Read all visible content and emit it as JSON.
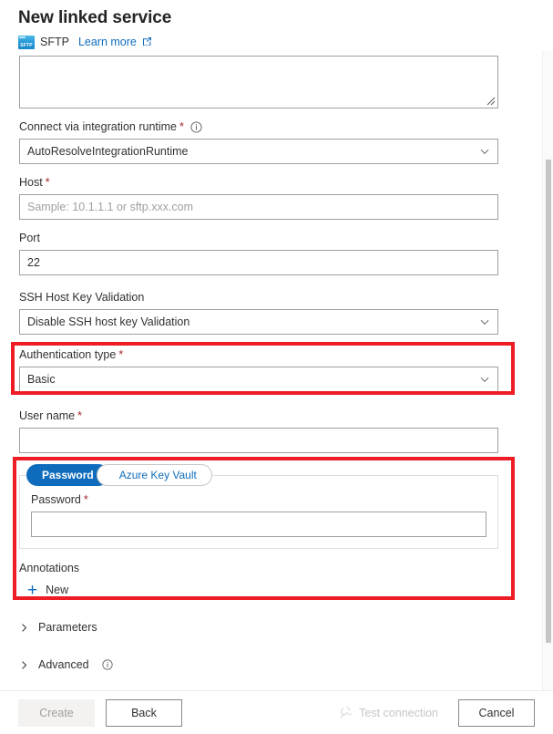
{
  "header": {
    "title": "New linked service",
    "service_icon": "sftp-icon",
    "service_tag": "SFTP",
    "service_label": "SFTP",
    "learn_more": "Learn more",
    "external_link_icon": "external-link-icon"
  },
  "form": {
    "description": {
      "value": "",
      "resize_grip_icon": "resize-grip-icon"
    },
    "integration_runtime": {
      "label": "Connect via integration runtime",
      "required": "*",
      "info_icon": "info-icon",
      "value": "AutoResolveIntegrationRuntime",
      "chevron_icon": "chevron-down-icon"
    },
    "host": {
      "label": "Host",
      "required": "*",
      "value": "",
      "placeholder": "Sample: 10.1.1.1 or sftp.xxx.com"
    },
    "port": {
      "label": "Port",
      "value": "22"
    },
    "ssh_host_key_validation": {
      "label": "SSH Host Key Validation",
      "value": "Disable SSH host key Validation",
      "chevron_icon": "chevron-down-icon"
    },
    "authentication_type": {
      "label": "Authentication type",
      "required": "*",
      "value": "Basic",
      "chevron_icon": "chevron-down-icon"
    },
    "user_name": {
      "label": "User name",
      "required": "*",
      "value": ""
    },
    "credential_tabs": {
      "password_label": "Password",
      "key_vault_label": "Azure Key Vault",
      "active": "Password"
    },
    "password": {
      "label": "Password",
      "required": "*",
      "value": ""
    },
    "annotations": {
      "label": "Annotations",
      "new_label": "New",
      "plus_icon": "plus-icon"
    },
    "parameters": {
      "label": "Parameters",
      "caret_icon": "chevron-right-icon"
    },
    "advanced": {
      "label": "Advanced",
      "caret_icon": "chevron-right-icon",
      "info_icon": "info-icon"
    }
  },
  "footer": {
    "create_label": "Create",
    "back_label": "Back",
    "test_connection_label": "Test connection",
    "test_connection_icon": "plug-icon",
    "cancel_label": "Cancel"
  },
  "colors": {
    "accent_blue": "#0f6cbd",
    "required_red": "#a4262c",
    "annotation_red": "#ee1c25",
    "disabled_grey": "#a19f9d"
  }
}
